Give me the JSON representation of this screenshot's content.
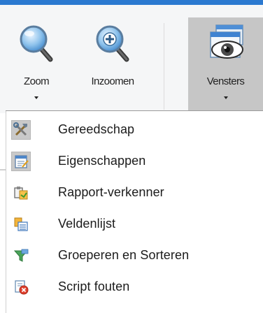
{
  "ribbon": {
    "buttons": [
      {
        "label": "Zoom",
        "icon": "zoom-icon",
        "has_dropdown": true
      },
      {
        "label": "Inzoomen",
        "icon": "zoom-in-icon",
        "has_dropdown": false
      },
      {
        "label": "Vensters",
        "icon": "windows-eye-icon",
        "has_dropdown": true,
        "active": true
      }
    ]
  },
  "menu": {
    "items": [
      {
        "label": "Gereedschap",
        "icon": "toolbox-icon",
        "checked": true
      },
      {
        "label": "Eigenschappen",
        "icon": "properties-icon",
        "checked": true
      },
      {
        "label": "Rapport-verkenner",
        "icon": "report-explorer-icon",
        "checked": false
      },
      {
        "label": "Veldenlijst",
        "icon": "field-list-icon",
        "checked": false
      },
      {
        "label": "Groeperen en Sorteren",
        "icon": "group-sort-icon",
        "checked": false
      },
      {
        "label": "Script fouten",
        "icon": "script-errors-icon",
        "checked": false
      }
    ]
  },
  "colors": {
    "accent_bar": "#2b79d0",
    "active_button": "#c6c6c6",
    "checked_icon_bg": "#c9c9c9"
  }
}
